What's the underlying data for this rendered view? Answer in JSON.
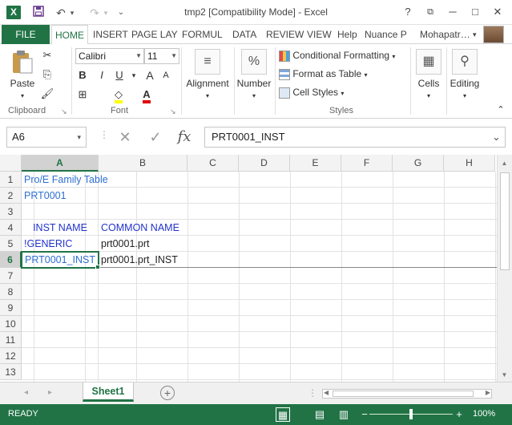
{
  "window": {
    "title": "tmp2  [Compatibility Mode] - Excel",
    "app_icon": "X",
    "help": "?",
    "restore": "⧉",
    "minimize": "─",
    "maximize": "□",
    "close": "✕"
  },
  "qat": {
    "save": "💾",
    "undo": "↶",
    "undo_dd": "▾",
    "redo": "↷",
    "redo_dd": "▾",
    "customize": "⌄"
  },
  "tabs": {
    "file": "FILE",
    "home": "HOME",
    "insert": "INSERT",
    "page_layout": "PAGE LAY",
    "formulas": "FORMUL",
    "data": "DATA",
    "review": "REVIEW",
    "view": "VIEW",
    "help": "Help",
    "nuance": "Nuance P",
    "user": "Mohapatr…",
    "user_dd": "▾"
  },
  "ribbon": {
    "clipboard": {
      "paste": "Paste",
      "paste_dd": "▾",
      "label": "Clipboard"
    },
    "font": {
      "name": "Calibri",
      "size": "11",
      "bold": "B",
      "italic": "I",
      "underline": "U",
      "grow": "A",
      "shrink": "A",
      "font_color": "A",
      "label": "Font"
    },
    "alignment": {
      "label": "Alignment",
      "dd": "▾"
    },
    "number": {
      "symbol": "%",
      "label": "Number",
      "dd": "▾"
    },
    "styles": {
      "conditional": "Conditional Formatting",
      "format_table": "Format as Table",
      "cell_styles": "Cell Styles",
      "label": "Styles"
    },
    "cells": {
      "label": "Cells",
      "dd": "▾"
    },
    "editing": {
      "label": "Editing",
      "dd": "▾"
    },
    "collapse": "⌃",
    "launcher": "↘"
  },
  "formula_bar": {
    "name_box": "A6",
    "name_box_dd": "▾",
    "cancel": "✕",
    "enter": "✓",
    "fx": "fx",
    "value": "PRT0001_INST",
    "expand": "⌄"
  },
  "grid": {
    "columns": [
      "A",
      "B",
      "C",
      "D",
      "E",
      "F",
      "G",
      "H"
    ],
    "rows": [
      "1",
      "2",
      "3",
      "4",
      "5",
      "6",
      "7",
      "8",
      "9",
      "10",
      "11",
      "12",
      "13"
    ],
    "cells": {
      "A1": "Pro/E Family Table",
      "A2": "PRT0001",
      "A4": "INST NAME",
      "B4": "COMMON NAME",
      "A5": "!GENERIC",
      "B5": "prt0001.prt",
      "A6": "PRT0001_INST",
      "B6": "prt0001.prt_INST"
    },
    "selected_cell": "A6"
  },
  "sheets": {
    "active": "Sheet1",
    "add": "+",
    "prev": "◂",
    "next": "▸"
  },
  "status": {
    "ready": "READY",
    "normal_view": "▦",
    "page_layout_view": "▤",
    "page_break_view": "▥",
    "zoom_out": "−",
    "zoom_in": "+",
    "zoom": "100%"
  },
  "colors": {
    "accent": "#217346",
    "text_blue": "#2e6fd1",
    "header_blue": "#2233cc"
  }
}
